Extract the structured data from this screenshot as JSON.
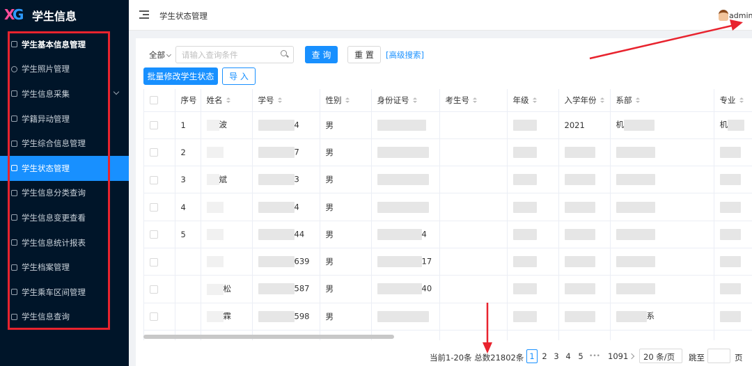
{
  "app": {
    "title": "学生信息"
  },
  "sidebar": {
    "items": [
      {
        "label": "学生基本信息管理",
        "icon": "document-icon"
      },
      {
        "label": "学生照片管理",
        "icon": "camera-icon"
      },
      {
        "label": "学生信息采集",
        "icon": "edit-icon"
      },
      {
        "label": "学籍异动管理",
        "icon": "graduation-cap-icon"
      },
      {
        "label": "学生综合信息管理",
        "icon": "document-icon"
      },
      {
        "label": "学生状态管理",
        "icon": "document-icon"
      },
      {
        "label": "学生信息分类查询",
        "icon": "document-icon"
      },
      {
        "label": "学生信息变更查看",
        "icon": "document-icon"
      },
      {
        "label": "学生信息统计报表",
        "icon": "document-icon"
      },
      {
        "label": "学生档案管理",
        "icon": "document-icon"
      },
      {
        "label": "学生乘车区间管理",
        "icon": "document-icon"
      },
      {
        "label": "学生信息查询",
        "icon": "document-icon"
      }
    ],
    "active_index": 5
  },
  "header": {
    "page_title": "学生状态管理",
    "user": "admin"
  },
  "toolbar": {
    "scope_select": "全部",
    "search_placeholder": "请输入查询条件",
    "query_label": "查 询",
    "reset_label": "重 置",
    "advanced_label": "[高级搜索]",
    "batch_label": "批量修改学生状态",
    "import_label": "导 入"
  },
  "table": {
    "columns": [
      "",
      "序号",
      "姓名",
      "学号",
      "性别",
      "身份证号",
      "考生号",
      "年级",
      "入学年份",
      "系部",
      "专业"
    ],
    "rows": [
      {
        "seq": "1",
        "name": "波",
        "id": "4",
        "gender": "男",
        "idcard": "",
        "year": "2021",
        "dept": "机",
        "major": "机"
      },
      {
        "seq": "2",
        "name": "",
        "id": "7",
        "gender": "男",
        "idcard": "",
        "year": "",
        "dept": "",
        "major": ""
      },
      {
        "seq": "3",
        "name": "斌",
        "id": "3",
        "gender": "男",
        "idcard": "",
        "year": "",
        "dept": "",
        "major": ""
      },
      {
        "seq": "4",
        "name": "",
        "id": "4",
        "gender": "男",
        "idcard": "",
        "year": "",
        "dept": "",
        "major": ""
      },
      {
        "seq": "5",
        "name": "",
        "id": "44",
        "gender": "男",
        "idcard": "4",
        "year": "",
        "dept": "",
        "major": ""
      },
      {
        "seq": "",
        "name": "",
        "id": "639",
        "gender": "男",
        "idcard": "17",
        "year": "",
        "dept": "",
        "major": ""
      },
      {
        "seq": "",
        "name": "松",
        "id": "587",
        "gender": "男",
        "idcard": "40",
        "year": "",
        "dept": "",
        "major": ""
      },
      {
        "seq": "",
        "name": "霖",
        "id": "598",
        "gender": "男",
        "idcard": "",
        "year": "",
        "dept": "系",
        "major": ""
      }
    ]
  },
  "pagination": {
    "summary": "当前1-20条 总数21802条",
    "pages": [
      "1",
      "2",
      "3",
      "4",
      "5"
    ],
    "ellipsis": "•••",
    "last_page": "1091",
    "page_size": "20 条/页",
    "jump_prefix": "跳至",
    "jump_suffix": "页"
  },
  "colors": {
    "sidebar_bg": "#001529",
    "accent": "#1890ff",
    "annotation": "#e8232e"
  }
}
